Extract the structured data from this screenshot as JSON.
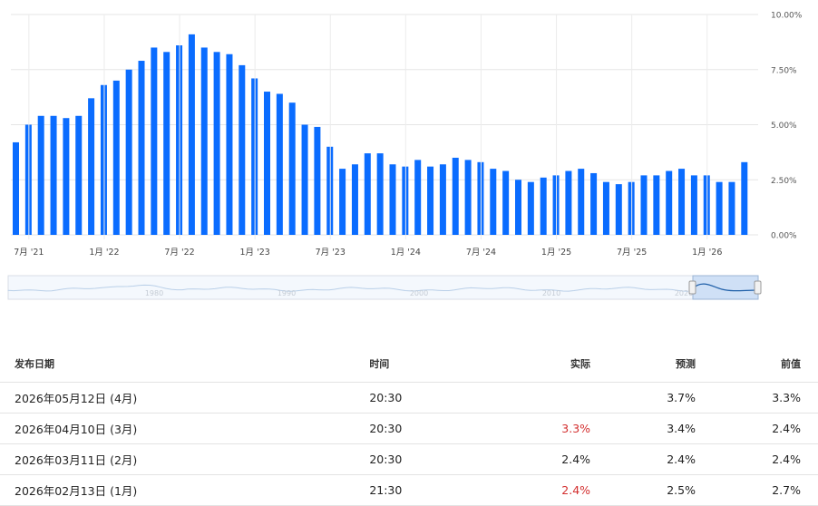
{
  "chart_data": {
    "type": "bar",
    "categories": [
      "7月 '21",
      "1月 '22",
      "7月 '22",
      "1月 '23",
      "7月 '23",
      "1月 '24",
      "7月 '24",
      "1月 '25",
      "7月 '25",
      "1月 '26"
    ],
    "values": [
      4.2,
      5.0,
      5.4,
      5.4,
      5.3,
      5.4,
      6.2,
      6.8,
      7.0,
      7.5,
      7.9,
      8.5,
      8.3,
      8.6,
      9.1,
      8.5,
      8.3,
      8.2,
      7.7,
      7.1,
      6.5,
      6.4,
      6.0,
      5.0,
      4.9,
      4.0,
      3.0,
      3.2,
      3.7,
      3.7,
      3.2,
      3.1,
      3.4,
      3.1,
      3.2,
      3.5,
      3.4,
      3.3,
      3.0,
      2.9,
      2.5,
      2.4,
      2.6,
      2.7,
      2.9,
      3.0,
      2.8,
      2.4,
      2.3,
      2.4,
      2.7,
      2.7,
      2.9,
      3.0,
      2.7,
      2.7,
      2.4,
      2.4,
      3.3
    ],
    "y_ticks": [
      "10.00%",
      "7.50%",
      "5.00%",
      "2.50%",
      "0.00%"
    ],
    "ylim": [
      0,
      10
    ],
    "bar_color": "#0a6cff",
    "grid": true,
    "navigator_labels": [
      "1980",
      "1990",
      "2000",
      "2010",
      "2020"
    ]
  },
  "table": {
    "headers": {
      "date": "发布日期",
      "time": "时间",
      "actual": "实际",
      "forecast": "预测",
      "previous": "前值"
    },
    "rows": [
      {
        "date": "2026年05月12日 (4月)",
        "time": "20:30",
        "actual": "",
        "forecast": "3.7%",
        "previous": "3.3%"
      },
      {
        "date": "2026年04月10日 (3月)",
        "time": "20:30",
        "actual": "3.3%",
        "forecast": "3.4%",
        "previous": "2.4%",
        "actual_color": "#d32f2f"
      },
      {
        "date": "2026年03月11日 (2月)",
        "time": "20:30",
        "actual": "2.4%",
        "forecast": "2.4%",
        "previous": "2.4%"
      },
      {
        "date": "2026年02月13日 (1月)",
        "time": "21:30",
        "actual": "2.4%",
        "forecast": "2.5%",
        "previous": "2.7%",
        "actual_color": "#d32f2f"
      }
    ]
  }
}
